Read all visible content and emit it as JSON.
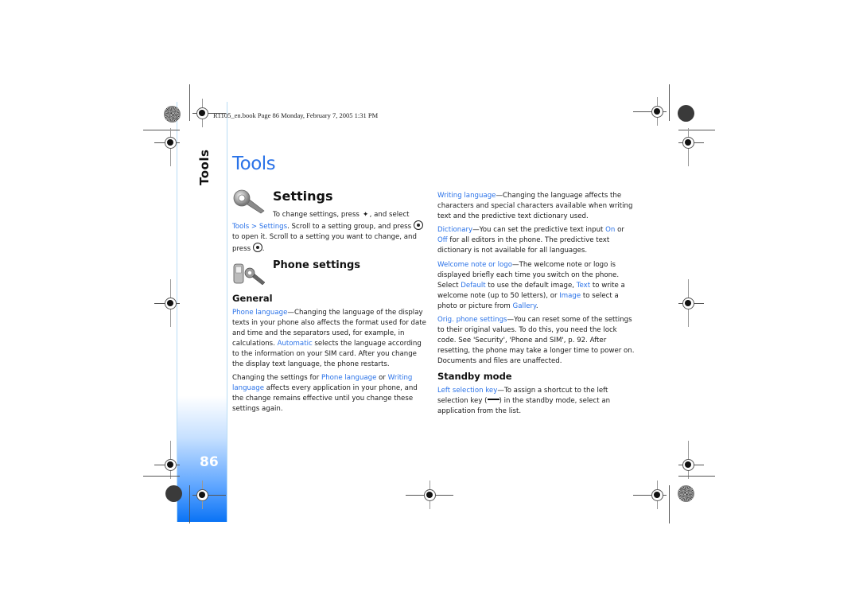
{
  "book_header": "R1105_en.book  Page 86  Monday, February 7, 2005  1:31 PM",
  "sidebar": {
    "section_label": "Tools",
    "page_number": "86"
  },
  "chapter_title": "Tools",
  "settings": {
    "title": "Settings",
    "intro_line1_a": "To change settings, press",
    "intro_line1_b": ", and select",
    "link_tools_settings": "Tools > Settings",
    "intro_rest1": ". Scroll to a setting group, and press",
    "intro_rest2": "to open it. Scroll to a setting you want to change, and",
    "intro_rest3": "press",
    "intro_rest4": "."
  },
  "phone_settings": {
    "title": "Phone settings",
    "general_title": "General",
    "phone_language": {
      "term": "Phone language",
      "text1": "—Changing the language of the display texts in your phone also affects the format used for date and time and the separators used, for example, in calculations. ",
      "automatic": "Automatic",
      "text2": " selects the language according to the information on your SIM card. After you change the display text language, the phone restarts."
    },
    "changing": {
      "text1": "Changing the settings for ",
      "phone_language": "Phone language",
      "or": " or ",
      "writing_language": "Writing language",
      "text2": " affects every application in your phone, and the change remains effective until you change these settings again."
    }
  },
  "right_column": {
    "writing_language": {
      "term": "Writing language",
      "text": "—Changing the language affects the characters and special characters available when writing text and the predictive text dictionary used."
    },
    "dictionary": {
      "term": "Dictionary",
      "text1": "—You can set the predictive text input ",
      "on": "On",
      "or": " or ",
      "off": "Off",
      "text2": " for all editors in the phone. The predictive text dictionary is not available for all languages."
    },
    "welcome_note": {
      "term": "Welcome note or logo",
      "text1": "—The welcome note or logo is displayed briefly each time you switch on the phone. Select ",
      "default": "Default",
      "text2": " to use the default image, ",
      "text_opt": "Text",
      "text3": " to write a welcome note (up to 50 letters), or ",
      "image": "Image",
      "text4": " to select a photo or picture from ",
      "gallery": "Gallery",
      "text5": "."
    },
    "orig_settings": {
      "term": "Orig. phone settings",
      "text": "—You can reset some of the settings to their original values. To do this, you need the lock code. See 'Security', 'Phone and SIM', p. 92. After resetting, the phone may take a longer time to power on. Documents and files are unaffected."
    },
    "standby_title": "Standby mode",
    "left_selection_key": {
      "term": "Left selection key",
      "text1": "—To assign a shortcut to the left selection key (",
      "text2": ") in the standby mode, select an application from the list."
    }
  },
  "icons": {
    "settings": "wrench-icon",
    "phone_settings": "phone-wrench-icon",
    "menu_key": "menu-key-icon",
    "select_key": "joystick-select-icon",
    "left_key": "left-selection-key-icon"
  },
  "colors": {
    "accent": "#2a72e8",
    "strip_bottom": "#0a73f5"
  }
}
